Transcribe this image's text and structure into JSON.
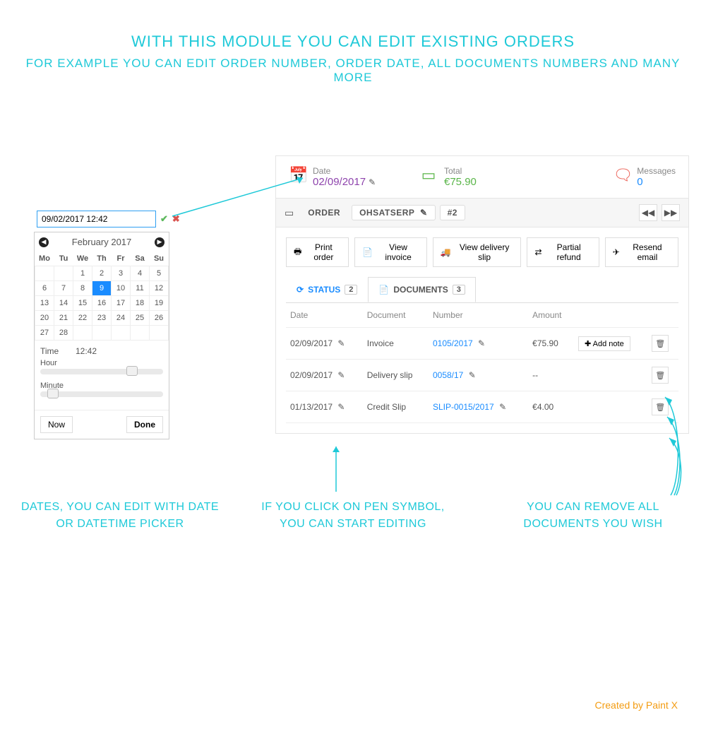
{
  "headline": {
    "line1": "WITH THIS MODULE YOU CAN EDIT EXISTING ORDERS",
    "line2": "FOR EXAMPLE YOU CAN EDIT ORDER NUMBER, ORDER DATE, ALL DOCUMENTS NUMBERS AND MANY MORE"
  },
  "picker": {
    "input_value": "09/02/2017 12:42",
    "month_title": "February 2017",
    "dow": [
      "Mo",
      "Tu",
      "We",
      "Th",
      "Fr",
      "Sa",
      "Su"
    ],
    "weeks": [
      [
        "",
        "",
        "1",
        "2",
        "3",
        "4",
        "5"
      ],
      [
        "6",
        "7",
        "8",
        "9",
        "10",
        "11",
        "12"
      ],
      [
        "13",
        "14",
        "15",
        "16",
        "17",
        "18",
        "19"
      ],
      [
        "20",
        "21",
        "22",
        "23",
        "24",
        "25",
        "26"
      ],
      [
        "27",
        "28",
        "",
        "",
        "",
        "",
        ""
      ]
    ],
    "selected_day": "9",
    "time_label": "Time",
    "time_value": "12:42",
    "hour_label": "Hour",
    "minute_label": "Minute",
    "now": "Now",
    "done": "Done"
  },
  "metrics": {
    "date": {
      "label": "Date",
      "value": "02/09/2017"
    },
    "total": {
      "label": "Total",
      "value": "€75.90"
    },
    "messages": {
      "label": "Messages",
      "value": "0"
    }
  },
  "orderbar": {
    "order_label": "ORDER",
    "ref": "OHSATSERP",
    "seq": "#2"
  },
  "actions": {
    "print": "Print order",
    "view_invoice": "View invoice",
    "view_delivery": "View delivery slip",
    "partial_refund": "Partial refund",
    "resend": "Resend email"
  },
  "tabs": {
    "status": "STATUS",
    "status_count": "2",
    "documents": "DOCUMENTS",
    "documents_count": "3"
  },
  "table": {
    "head": {
      "date": "Date",
      "document": "Document",
      "number": "Number",
      "amount": "Amount"
    },
    "rows": [
      {
        "date": "02/09/2017",
        "doc": "Invoice",
        "number": "0105/2017",
        "amount": "€75.90",
        "add_note": "Add note"
      },
      {
        "date": "02/09/2017",
        "doc": "Delivery slip",
        "number": "0058/17",
        "amount": "--",
        "add_note": ""
      },
      {
        "date": "01/13/2017",
        "doc": "Credit Slip",
        "number": "SLIP-0015/2017",
        "amount": "€4.00",
        "add_note": ""
      }
    ]
  },
  "captions": {
    "c1": "DATES, YOU CAN EDIT WITH DATE OR DATETIME PICKER",
    "c2": "IF YOU CLICK ON PEN SYMBOL, YOU CAN START EDITING",
    "c3": "YOU CAN REMOVE ALL DOCUMENTS YOU WISH"
  },
  "credit": "Created by Paint X",
  "icons": {
    "plus": "✚",
    "trash": "🗑"
  }
}
